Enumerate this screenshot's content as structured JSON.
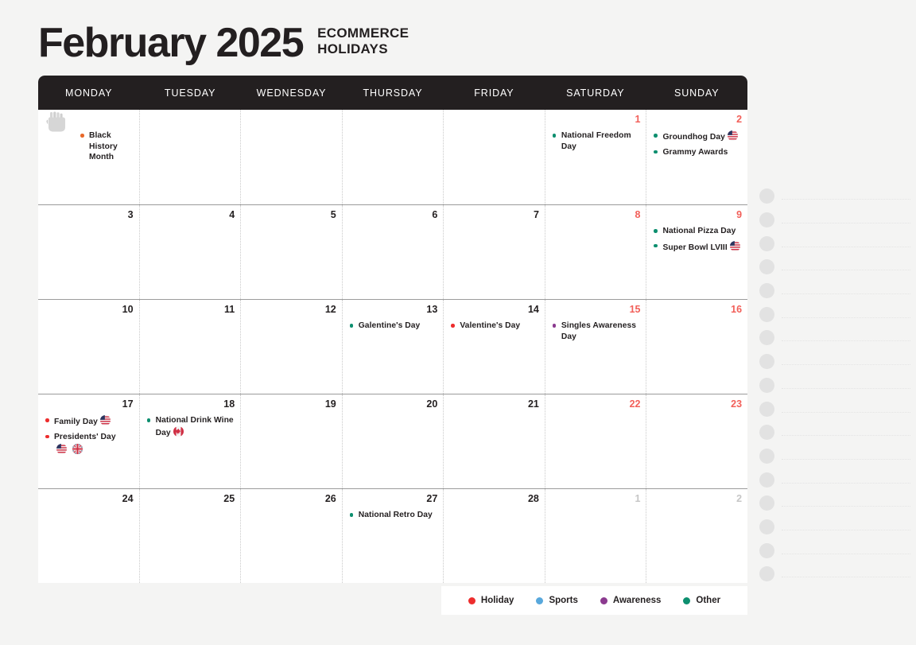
{
  "header": {
    "month_title": "February 2025",
    "subtitle_line1": "ECOMMERCE",
    "subtitle_line2": "HOLIDAYS"
  },
  "colors": {
    "holiday": "#ed2d2d",
    "sports": "#58a8dc",
    "awareness": "#8b3a8f",
    "other": "#0d8f6f",
    "weekend_date": "#f2605a",
    "muted_date": "#c6c6c6",
    "header_bg": "#231f20",
    "page_bg": "#f4f4f3"
  },
  "day_headers": [
    "MONDAY",
    "TUESDAY",
    "WEDNESDAY",
    "THURSDAY",
    "FRIDAY",
    "SATURDAY",
    "SUNDAY"
  ],
  "legend": [
    {
      "label": "Holiday",
      "color": "#ed2d2d"
    },
    {
      "label": "Sports",
      "color": "#58a8dc"
    },
    {
      "label": "Awareness",
      "color": "#8b3a8f"
    },
    {
      "label": "Other",
      "color": "#0d8f6f"
    }
  ],
  "weeks": [
    [
      {
        "day": "",
        "state": "blank",
        "fist_icon": true,
        "events": [
          {
            "text": "Black History Month",
            "color": "#e8692a",
            "flags": []
          }
        ]
      },
      {
        "day": "",
        "state": "blank",
        "events": []
      },
      {
        "day": "",
        "state": "blank",
        "events": []
      },
      {
        "day": "",
        "state": "blank",
        "events": []
      },
      {
        "day": "",
        "state": "blank",
        "events": []
      },
      {
        "day": "1",
        "state": "weekend",
        "events": [
          {
            "text": "National Freedom Day",
            "color": "#0d8f6f",
            "flags": []
          }
        ]
      },
      {
        "day": "2",
        "state": "weekend",
        "events": [
          {
            "text": "Groundhog Day",
            "color": "#0d8f6f",
            "flags": [
              "us"
            ]
          },
          {
            "text": "Grammy Awards",
            "color": "#0d8f6f",
            "flags": []
          }
        ]
      }
    ],
    [
      {
        "day": "3",
        "state": "normal",
        "events": []
      },
      {
        "day": "4",
        "state": "normal",
        "events": []
      },
      {
        "day": "5",
        "state": "normal",
        "events": []
      },
      {
        "day": "6",
        "state": "normal",
        "events": []
      },
      {
        "day": "7",
        "state": "normal",
        "events": []
      },
      {
        "day": "8",
        "state": "weekend",
        "events": []
      },
      {
        "day": "9",
        "state": "weekend",
        "events": [
          {
            "text": "National Pizza Day",
            "color": "#0d8f6f",
            "flags": []
          },
          {
            "text": "Super Bowl LVIII",
            "color": "#0d8f6f",
            "flags": [
              "us"
            ]
          }
        ]
      }
    ],
    [
      {
        "day": "10",
        "state": "normal",
        "events": []
      },
      {
        "day": "11",
        "state": "normal",
        "events": []
      },
      {
        "day": "12",
        "state": "normal",
        "events": []
      },
      {
        "day": "13",
        "state": "normal",
        "events": [
          {
            "text": "Galentine's Day",
            "color": "#0d8f6f",
            "flags": []
          }
        ]
      },
      {
        "day": "14",
        "state": "normal",
        "events": [
          {
            "text": "Valentine's Day",
            "color": "#ed2d2d",
            "flags": []
          }
        ]
      },
      {
        "day": "15",
        "state": "weekend",
        "events": [
          {
            "text": "Singles Awareness Day",
            "color": "#8b3a8f",
            "flags": []
          }
        ]
      },
      {
        "day": "16",
        "state": "weekend",
        "events": []
      }
    ],
    [
      {
        "day": "17",
        "state": "normal",
        "events": [
          {
            "text": "Family Day",
            "color": "#ed2d2d",
            "flags": [
              "us"
            ]
          },
          {
            "text": "Presidents' Day",
            "color": "#ed2d2d",
            "flags": [
              "us",
              "uk"
            ],
            "flags_below": true
          }
        ]
      },
      {
        "day": "18",
        "state": "normal",
        "events": [
          {
            "text": "National Drink Wine Day",
            "color": "#0d8f6f",
            "flags": [
              "ca"
            ]
          }
        ]
      },
      {
        "day": "19",
        "state": "normal",
        "events": []
      },
      {
        "day": "20",
        "state": "normal",
        "events": []
      },
      {
        "day": "21",
        "state": "normal",
        "events": []
      },
      {
        "day": "22",
        "state": "weekend",
        "events": []
      },
      {
        "day": "23",
        "state": "weekend",
        "events": []
      }
    ],
    [
      {
        "day": "24",
        "state": "normal",
        "events": []
      },
      {
        "day": "25",
        "state": "normal",
        "events": []
      },
      {
        "day": "26",
        "state": "normal",
        "events": []
      },
      {
        "day": "27",
        "state": "normal",
        "events": [
          {
            "text": "National Retro Day",
            "color": "#0d8f6f",
            "flags": []
          }
        ]
      },
      {
        "day": "28",
        "state": "normal",
        "events": []
      },
      {
        "day": "1",
        "state": "muted",
        "events": []
      },
      {
        "day": "2",
        "state": "muted",
        "events": []
      }
    ]
  ],
  "notes_panel": {
    "row_count": 17
  }
}
